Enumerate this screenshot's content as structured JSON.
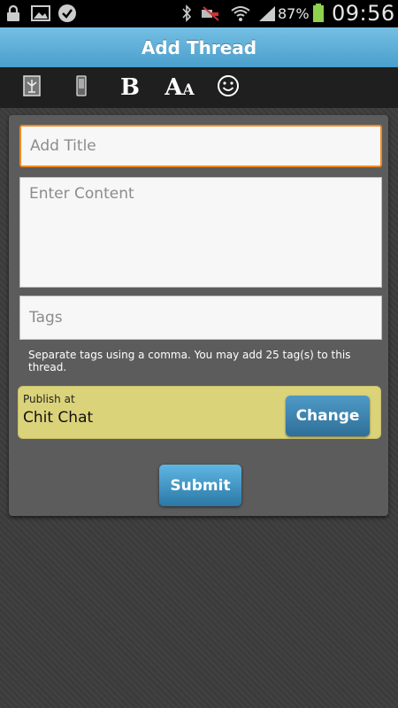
{
  "status_bar": {
    "battery_percent": "87%",
    "time": "09:56",
    "icons": [
      "lock-icon",
      "image-icon",
      "check-circle-icon",
      "bluetooth-icon",
      "mute-icon",
      "wifi-icon",
      "signal-icon",
      "battery-icon"
    ]
  },
  "header": {
    "title": "Add Thread"
  },
  "toolbar": {
    "buttons": [
      {
        "name": "insert-image",
        "icon": "image-icon"
      },
      {
        "name": "insert-media",
        "icon": "phone-icon"
      },
      {
        "name": "bold",
        "label": "B"
      },
      {
        "name": "font-size",
        "label": "AA"
      },
      {
        "name": "emoji",
        "icon": "smiley-icon"
      }
    ]
  },
  "form": {
    "title_placeholder": "Add Title",
    "content_placeholder": "Enter Content",
    "tags_placeholder": "Tags",
    "tags_hint": "Separate tags using a comma. You may add 25 tag(s) to this thread.",
    "publish_label": "Publish at",
    "publish_value": "Chit Chat",
    "change_label": "Change",
    "submit_label": "Submit"
  },
  "colors": {
    "header": "#5aafd9",
    "accent_focus": "#f38a1f",
    "publish_bg": "#dbd37a",
    "button": "#3f86b5"
  }
}
